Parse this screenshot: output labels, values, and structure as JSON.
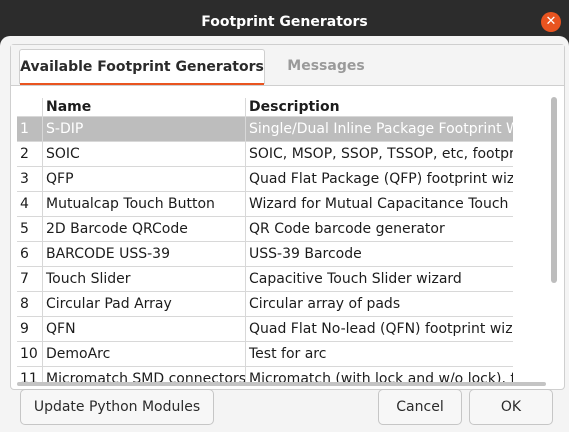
{
  "window": {
    "title": "Footprint Generators"
  },
  "tabs": [
    {
      "label": "Available Footprint Generators",
      "active": true
    },
    {
      "label": "Messages",
      "active": false
    }
  ],
  "table": {
    "headers": {
      "number": "",
      "name": "Name",
      "description": "Description"
    },
    "rows": [
      {
        "num": "1",
        "name": "S-DIP",
        "desc": "Single/Dual Inline Package Footprint Wiz",
        "selected": true
      },
      {
        "num": "2",
        "name": "SOIC",
        "desc": "SOIC, MSOP, SSOP, TSSOP, etc, footprint"
      },
      {
        "num": "3",
        "name": "QFP",
        "desc": "Quad Flat Package (QFP) footprint wizar"
      },
      {
        "num": "4",
        "name": "Mutualcap Touch Button",
        "desc": "Wizard for Mutual Capacitance Touch Bu"
      },
      {
        "num": "5",
        "name": "2D Barcode QRCode",
        "desc": "QR Code barcode generator"
      },
      {
        "num": "6",
        "name": "BARCODE USS-39",
        "desc": "USS-39 Barcode"
      },
      {
        "num": "7",
        "name": "Touch Slider",
        "desc": "Capacitive Touch Slider wizard"
      },
      {
        "num": "8",
        "name": "Circular Pad Array",
        "desc": "Circular array of pads"
      },
      {
        "num": "9",
        "name": "QFN",
        "desc": "Quad Flat No-lead (QFN) footprint wizar"
      },
      {
        "num": "10",
        "name": "DemoArc",
        "desc": "Test for arc"
      },
      {
        "num": "11",
        "name": "Micromatch SMD connectors",
        "desc": "Micromatch (with lock and w/o lock), foo"
      }
    ]
  },
  "buttons": {
    "update": "Update Python Modules",
    "cancel": "Cancel",
    "ok": "OK"
  },
  "colors": {
    "accent": "#e95420",
    "selected_row": "#bdbdbd",
    "titlebar": "#2c2c2c"
  },
  "icons": {
    "close": "close-icon"
  }
}
